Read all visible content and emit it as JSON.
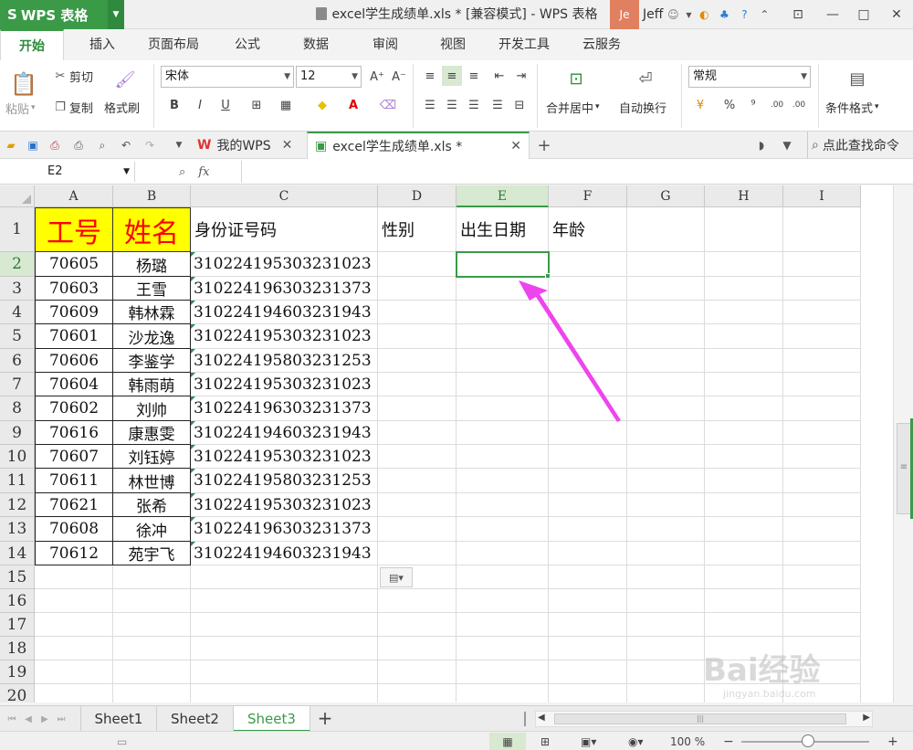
{
  "app": {
    "name": "WPS 表格",
    "logo": "S"
  },
  "window": {
    "title": "excel学生成绩单.xls * [兼容模式] - WPS 表格"
  },
  "user": {
    "avatar_text": "Je",
    "name": "Jeff"
  },
  "ribbon_tabs": [
    "开始",
    "插入",
    "页面布局",
    "公式",
    "数据",
    "审阅",
    "视图",
    "开发工具",
    "云服务"
  ],
  "ribbon": {
    "paste": "粘贴",
    "cut": "剪切",
    "copy": "复制",
    "format_painter": "格式刷",
    "font_name": "宋体",
    "font_size": "12",
    "merge_center": "合并居中",
    "wrap_text": "自动换行",
    "number_format": "常规",
    "percent": "%",
    "comma": "⁹",
    "cond_format": "条件格式",
    "inc_decimal": ".00",
    "dec_decimal": ".00"
  },
  "doc_tabs": [
    {
      "label": "我的WPS",
      "active": false
    },
    {
      "label": "excel学生成绩单.xls *",
      "active": true
    }
  ],
  "search_cmd": "点此查找命令",
  "formula_bar": {
    "name_box": "E2",
    "fx": "fx",
    "content": ""
  },
  "columns": [
    "A",
    "B",
    "C",
    "D",
    "E",
    "F",
    "G",
    "H",
    "I"
  ],
  "rows": [
    "1",
    "2",
    "3",
    "4",
    "5",
    "6",
    "7",
    "8",
    "9",
    "10",
    "11",
    "12",
    "13",
    "14",
    "15",
    "16",
    "17",
    "18",
    "19",
    "20"
  ],
  "headers": {
    "id": "工号",
    "name": "姓名",
    "idcard": "身份证号码",
    "gender": "性别",
    "birth": "出生日期",
    "age": "年龄"
  },
  "data_rows": [
    {
      "id": "70605",
      "name": "杨璐",
      "idcard": "310224195303231023"
    },
    {
      "id": "70603",
      "name": "王雪",
      "idcard": "310224196303231373"
    },
    {
      "id": "70609",
      "name": "韩林霖",
      "idcard": "310224194603231943"
    },
    {
      "id": "70601",
      "name": "沙龙逸",
      "idcard": "310224195303231023"
    },
    {
      "id": "70606",
      "name": "李鉴学",
      "idcard": "310224195803231253"
    },
    {
      "id": "70604",
      "name": "韩雨萌",
      "idcard": "310224195303231023"
    },
    {
      "id": "70602",
      "name": "刘帅",
      "idcard": "310224196303231373"
    },
    {
      "id": "70616",
      "name": "康惠雯",
      "idcard": "310224194603231943"
    },
    {
      "id": "70607",
      "name": "刘钰婷",
      "idcard": "310224195303231023"
    },
    {
      "id": "70611",
      "name": "林世博",
      "idcard": "310224195803231253"
    },
    {
      "id": "70621",
      "name": "张希",
      "idcard": "310224195303231023"
    },
    {
      "id": "70608",
      "name": "徐冲",
      "idcard": "310224196303231373"
    },
    {
      "id": "70612",
      "name": "苑宇飞",
      "idcard": "310224194603231943"
    }
  ],
  "sheets": [
    {
      "label": "Sheet1",
      "active": false
    },
    {
      "label": "Sheet2",
      "active": false
    },
    {
      "label": "Sheet3",
      "active": true
    }
  ],
  "status": {
    "zoom": "100 %"
  },
  "watermark": {
    "text": "Bai经验",
    "sub": "jingyan.baidu.com"
  },
  "colors": {
    "accent": "#3a9a48",
    "header_fill": "#ffff00",
    "header_text": "#ff0000",
    "arrow": "#ee44ee"
  }
}
